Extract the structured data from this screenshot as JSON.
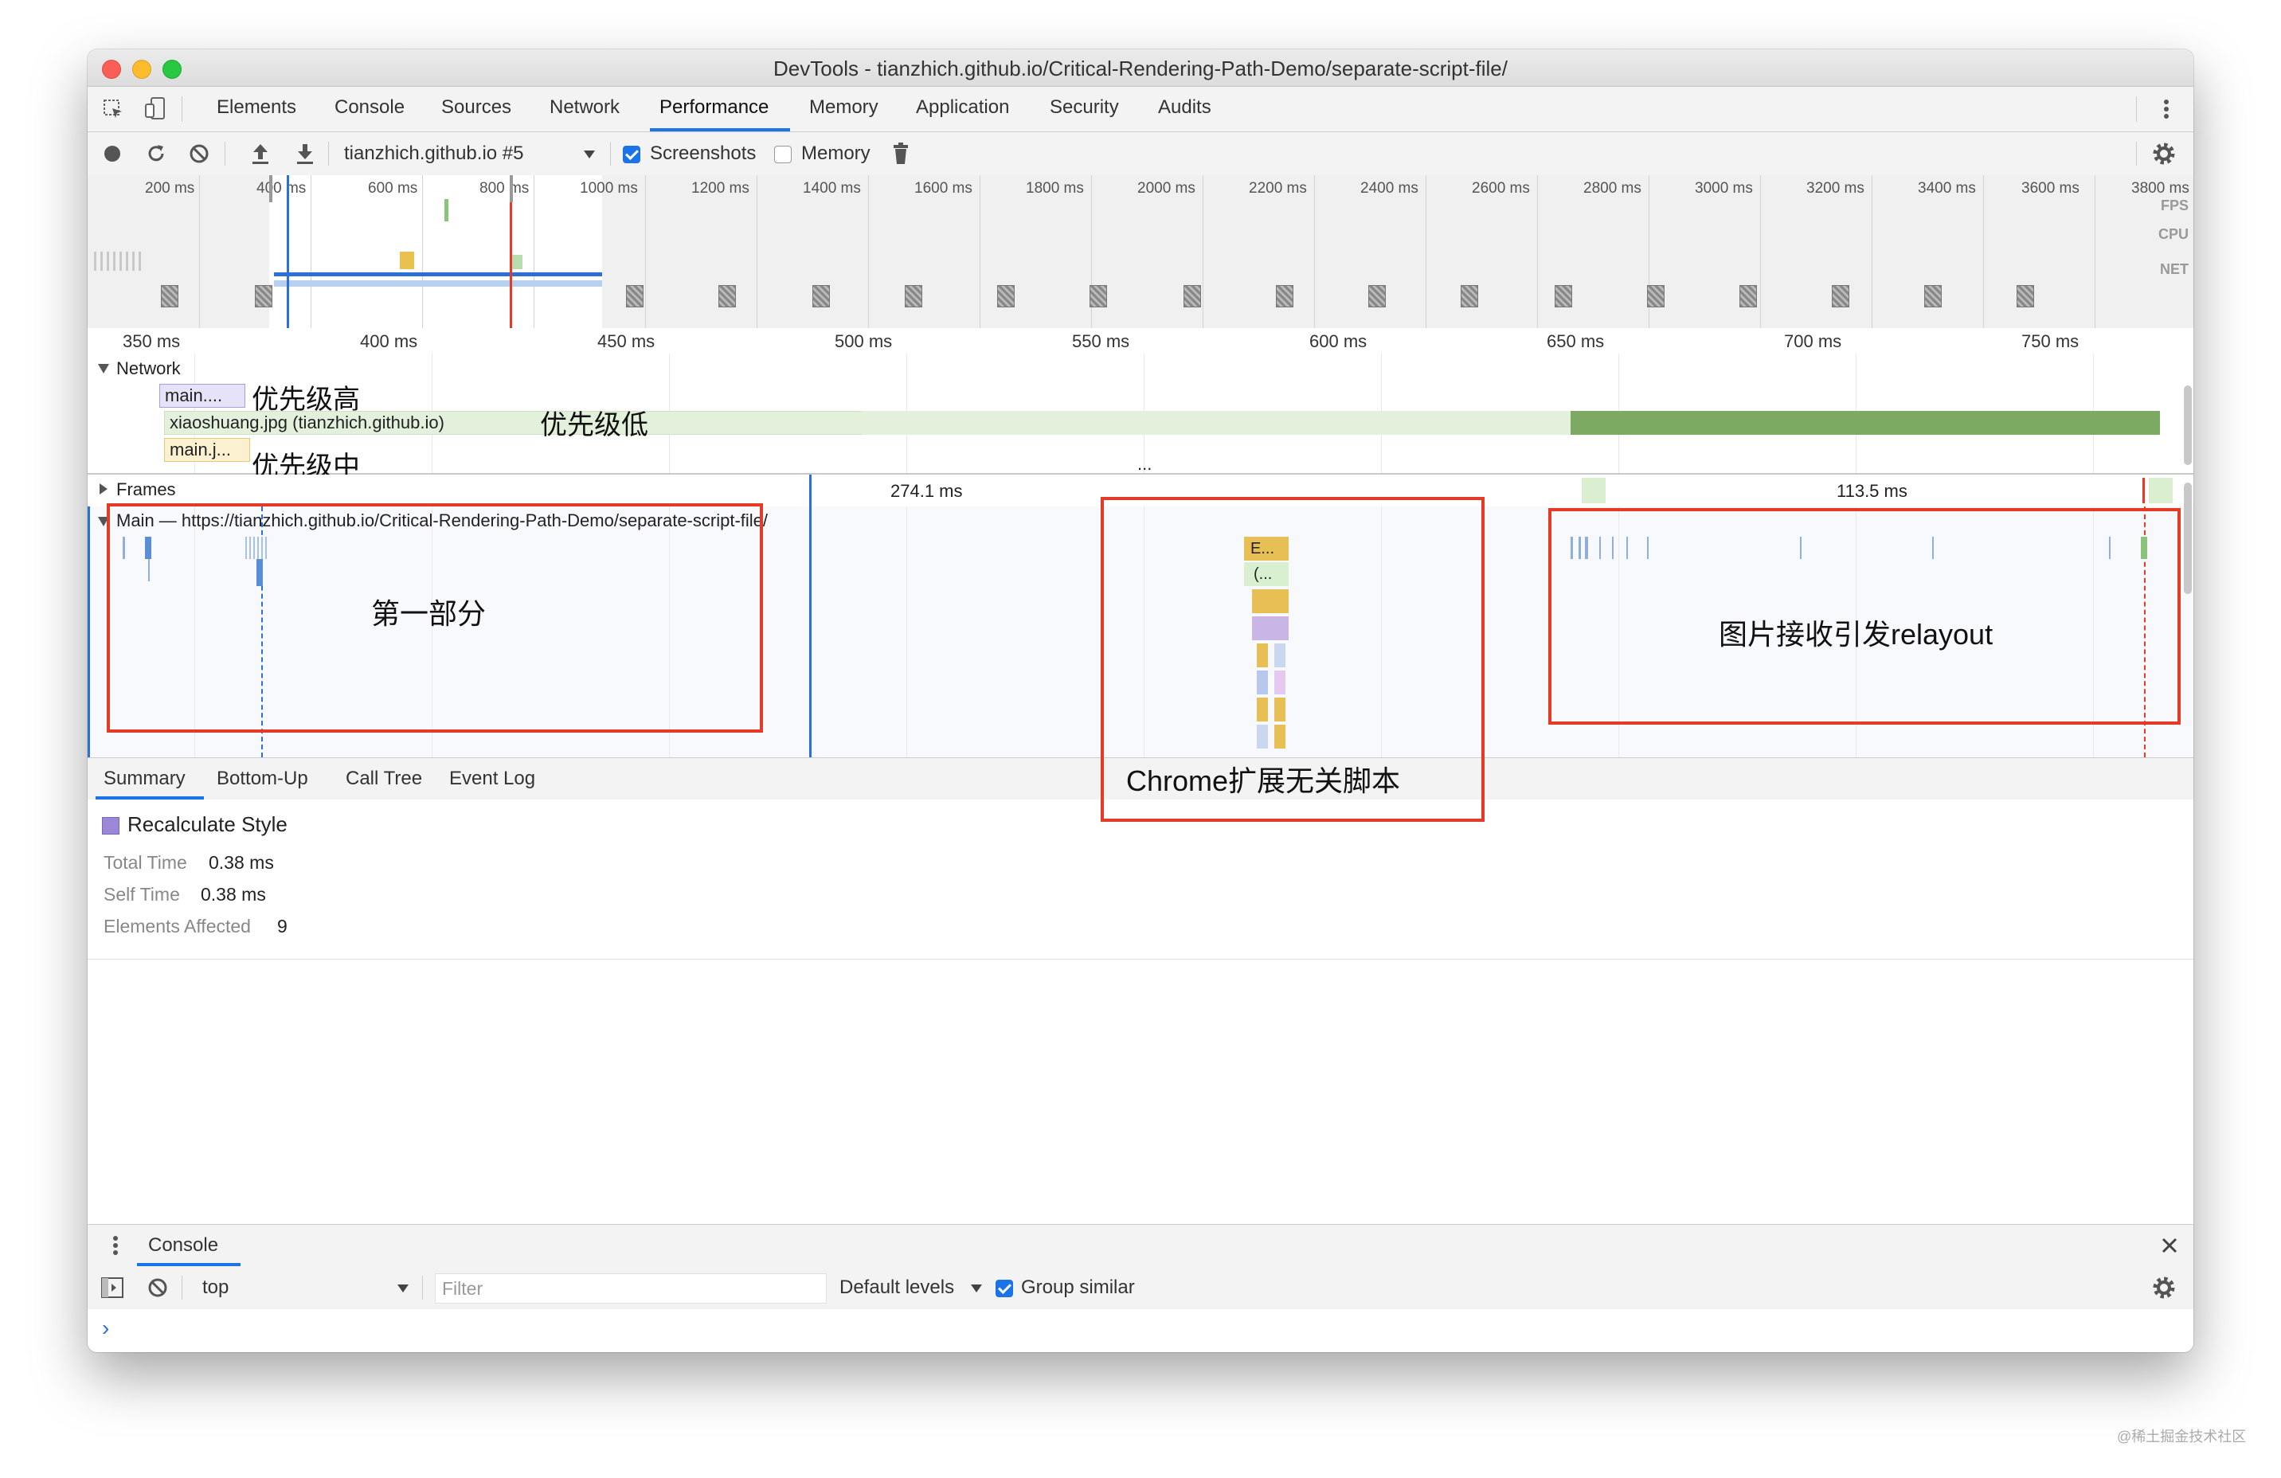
{
  "window": {
    "title": "DevTools - tianzhich.github.io/Critical-Rendering-Path-Demo/separate-script-file/"
  },
  "tabs": [
    "Elements",
    "Console",
    "Sources",
    "Network",
    "Performance",
    "Memory",
    "Application",
    "Security",
    "Audits"
  ],
  "active_tab": "Performance",
  "toolbar": {
    "profile_select": "tianzhich.github.io #5",
    "screenshots_label": "Screenshots",
    "screenshots_checked": true,
    "memory_label": "Memory",
    "memory_checked": false
  },
  "overview": {
    "labels": [
      "200 ms",
      "400 ms",
      "600 ms",
      "800 ms",
      "1000 ms",
      "1200 ms",
      "1400 ms",
      "1600 ms",
      "1800 ms",
      "2000 ms",
      "2200 ms",
      "2400 ms",
      "2600 ms",
      "2800 ms",
      "3000 ms",
      "3200 ms",
      "3400 ms",
      "3600 ms",
      "3800 ms"
    ],
    "side": {
      "fps": "FPS",
      "cpu": "CPU",
      "net": "NET"
    }
  },
  "ruler": [
    "350 ms",
    "400 ms",
    "450 ms",
    "500 ms",
    "550 ms",
    "600 ms",
    "650 ms",
    "700 ms",
    "750 ms"
  ],
  "network": {
    "label": "Network",
    "requests": [
      "main....",
      "xiaoshuang.jpg (tianzhich.github.io)",
      "main.j..."
    ],
    "annotations": {
      "high": "优先级高",
      "low": "优先级低",
      "mid": "优先级中"
    },
    "more": "..."
  },
  "frames": {
    "label": "Frames",
    "frame1": "274.1 ms",
    "frame2": "113.5 ms"
  },
  "main_track": {
    "label": "Main — https://tianzhich.github.io/Critical-Rendering-Path-Demo/separate-script-file/",
    "event1": "E...",
    "event2": "(..."
  },
  "annotations": {
    "first": "第一部分",
    "chrome": "Chrome扩展无关脚本",
    "relayout": "图片接收引发relayout"
  },
  "bottom_tabs": [
    "Summary",
    "Bottom-Up",
    "Call Tree",
    "Event Log"
  ],
  "summary": {
    "title": "Recalculate Style",
    "swatch_color": "#9b87d6",
    "total_time_label": "Total Time",
    "total_time": "0.38 ms",
    "self_time_label": "Self Time",
    "self_time": "0.38 ms",
    "elements_label": "Elements Affected",
    "elements": "9"
  },
  "console": {
    "title": "Console",
    "context": "top",
    "filter_placeholder": "Filter",
    "levels": "Default levels",
    "group_similar": "Group similar",
    "group_checked": true,
    "prompt": "›"
  },
  "watermark": "@稀土掘金技术社区"
}
